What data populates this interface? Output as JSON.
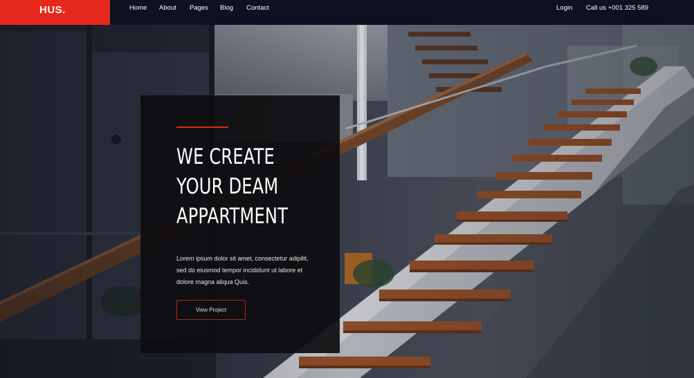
{
  "brand": {
    "logo": "HUS.",
    "accent": "#e5281b"
  },
  "nav": {
    "items": [
      "Home",
      "About",
      "Pages",
      "Blog",
      "Contact"
    ],
    "login": "Login",
    "call": "Call us +001 325 589"
  },
  "hero": {
    "headline": [
      "WE CREATE",
      "YOUR DEAM",
      "APPARTMENT"
    ],
    "body": [
      "Lorem ipsum dolor sit amet, consectetur adipilit,",
      "sed do eiusmod tempor incididunt ut labore et",
      "dolore magna aliqua Quis."
    ],
    "cta": "View Project"
  }
}
